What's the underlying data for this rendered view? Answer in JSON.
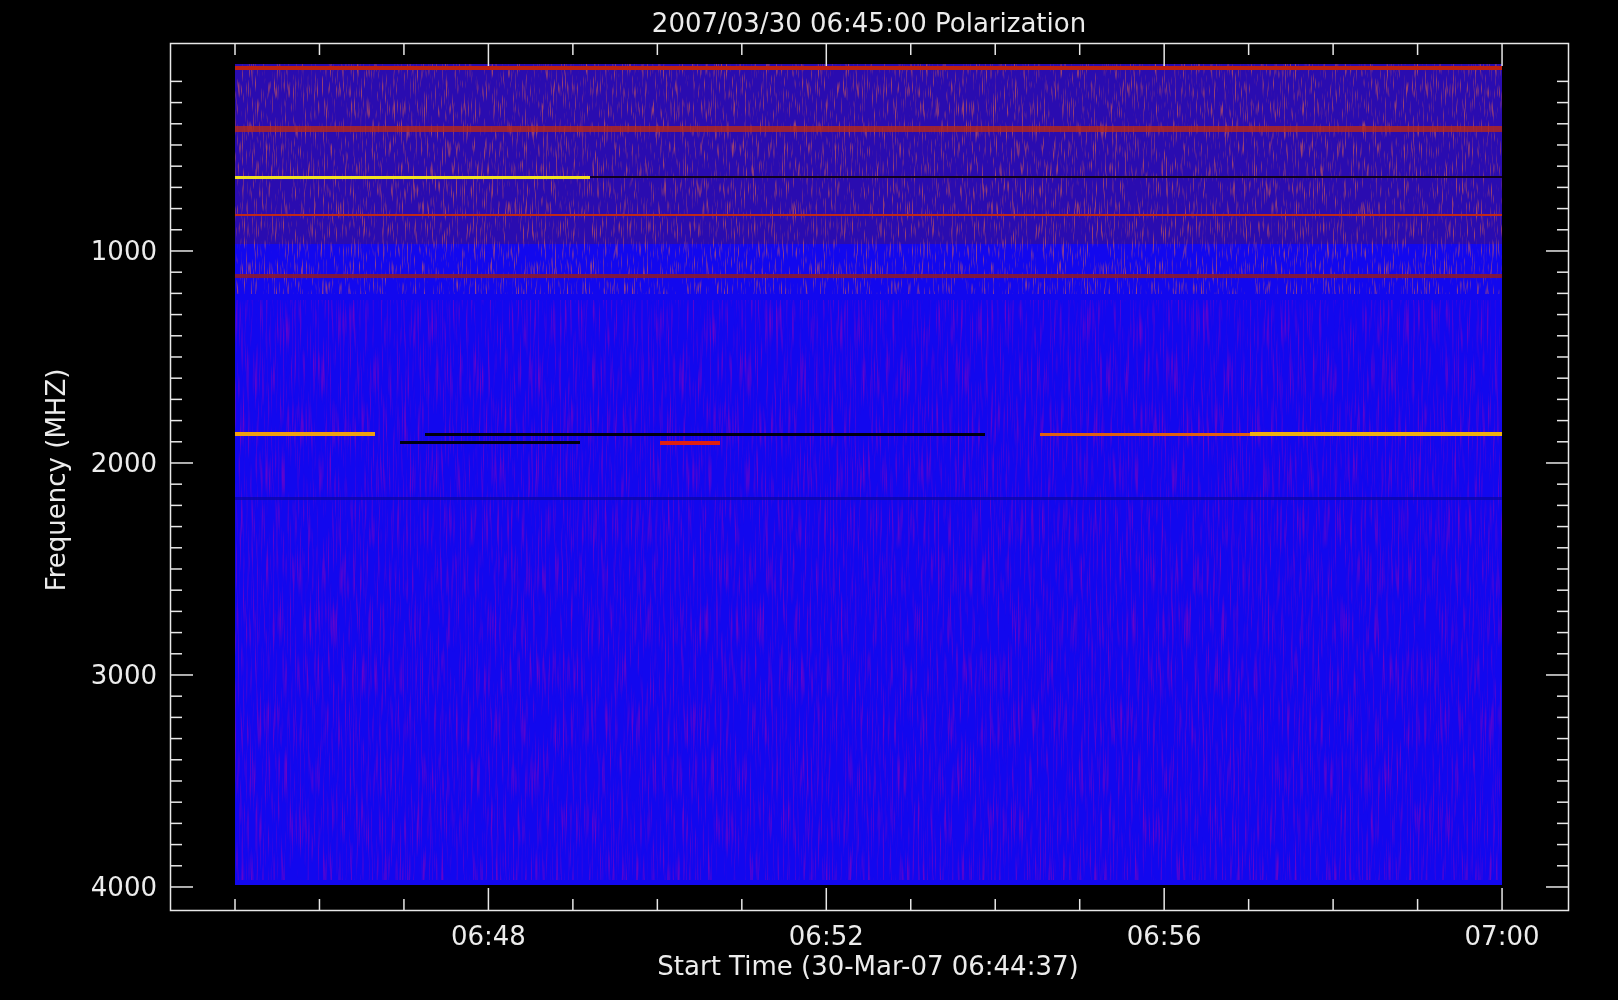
{
  "title": "2007/03/30 06:45:00 Polarization",
  "y_axis": {
    "label": "Frequency (MHZ)",
    "ticks": [
      "1000",
      "2000",
      "3000",
      "4000"
    ]
  },
  "x_axis": {
    "label": "Start Time (30-Mar-07 06:44:37)",
    "ticks": [
      "06:48",
      "06:52",
      "06:56",
      "07:00"
    ]
  }
}
